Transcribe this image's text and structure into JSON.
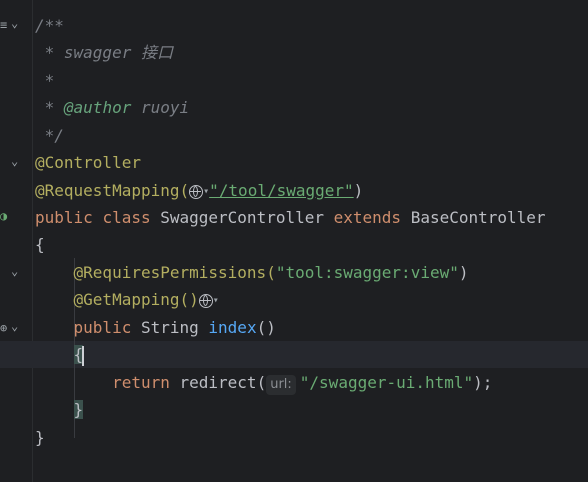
{
  "gutter": {
    "doc_toggle_icon": "≡",
    "fold_icon": "⌄",
    "bean_icon": "◑",
    "web_icon": "⊕"
  },
  "code": {
    "l1": "/**",
    "l2_prefix": " * swagger ",
    "l2_cjk": "接口",
    "l3": " *",
    "l4_prefix": " * ",
    "l4_tag": "@author",
    "l4_val": " ruoyi",
    "l5": " */",
    "l6": "@Controller",
    "l7_anno": "@RequestMapping(",
    "l7_str": "\"/tool/swagger\"",
    "l7_close": ")",
    "l8_kw1": "public ",
    "l8_kw2": "class ",
    "l8_cls": "SwaggerController ",
    "l8_kw3": "extends ",
    "l8_base": "BaseController",
    "l9": "{",
    "l10_anno": "@RequiresPermissions(",
    "l10_str": "\"tool:swagger:view\"",
    "l10_close": ")",
    "l11_anno": "@GetMapping()",
    "l12_kw": "public ",
    "l12_type": "String ",
    "l12_method": "index",
    "l12_paren": "()",
    "l13_brace": "{",
    "l14_kw": "return ",
    "l14_call": "redirect(",
    "l14_hint": "url:",
    "l14_str": "\"/swagger-ui.html\"",
    "l14_end": ");",
    "l15_brace": "}",
    "l16": "}"
  },
  "colors": {
    "background": "#1e1f22",
    "keyword": "#cf8e6d",
    "string": "#6aab73",
    "annotation": "#b3ae60",
    "method": "#56a8f5",
    "comment": "#7a7e85"
  }
}
